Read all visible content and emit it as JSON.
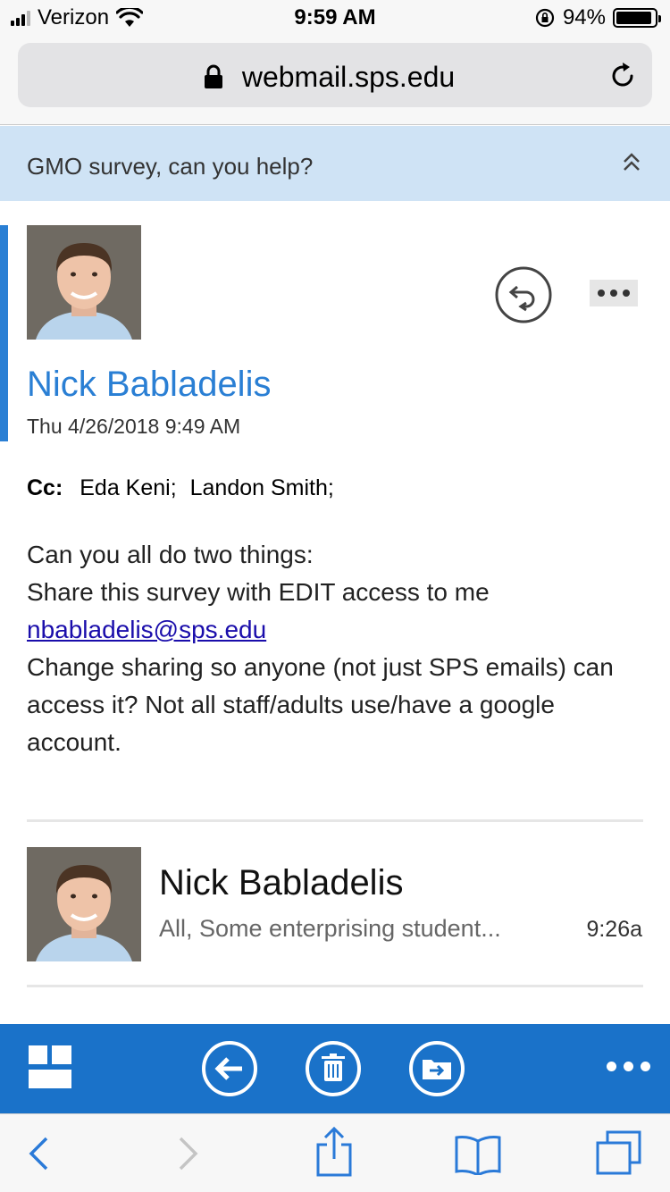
{
  "status_bar": {
    "carrier": "Verizon",
    "time": "9:59 AM",
    "battery": "94%",
    "battery_level": 0.94
  },
  "browser": {
    "url": "webmail.sps.edu"
  },
  "conversation": {
    "subject": "GMO survey, can you help?"
  },
  "message": {
    "sender": "Nick Babladelis",
    "date": "Thu 4/26/2018 9:49 AM",
    "cc_label": "Cc:",
    "cc": [
      "Eda Keni;",
      "Landon Smith;"
    ],
    "body": {
      "line1": "Can you all do two things:",
      "line2": "Share this survey with EDIT access to me",
      "link": "nbabladelis@sps.edu",
      "line3": "Change sharing so anyone (not just SPS emails) can access it? Not all staff/adults use/have a google account."
    }
  },
  "thread_item": {
    "sender": "Nick Babladelis",
    "preview": "All, Some enterprising student...",
    "time": "9:26a"
  },
  "toolbar": {
    "icons": [
      "grid-icon",
      "reply-back-icon",
      "trash-icon",
      "move-folder-icon",
      "more-icon"
    ],
    "color": "#1a72c9"
  },
  "colors": {
    "accent": "#2a7fd4",
    "banner": "#cfe3f5",
    "link": "#1a0dab"
  }
}
